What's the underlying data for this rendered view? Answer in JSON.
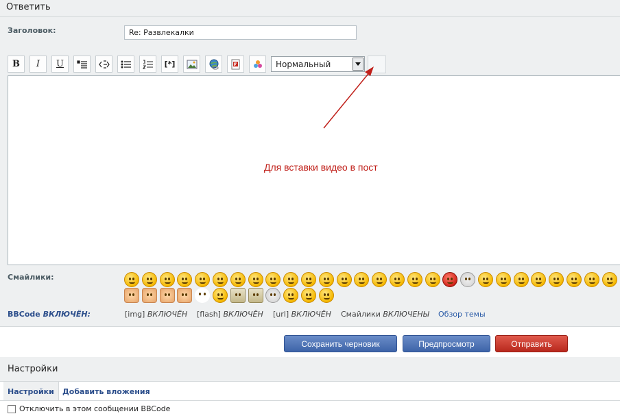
{
  "reply": {
    "title": "Ответить",
    "subject_label": "Заголовок:",
    "subject_value": "Re: Развлекалки"
  },
  "toolbar": {
    "bold": "B",
    "italic": "I",
    "underline": "U",
    "list_item": "[*]",
    "font_size_selected": "Нормальный"
  },
  "annotation": {
    "text": "Для вставки видео в пост",
    "color": "#c0201a"
  },
  "smileys": {
    "label": "Смайлики:",
    "icons": [
      "smile",
      "sad",
      "smile",
      "laugh",
      "cool",
      "confused",
      "neutral",
      "cry",
      "grin",
      "evil-grin",
      "surprised",
      "smile",
      "wink",
      "geek",
      "happy",
      "shocked",
      "sleepy",
      "smile",
      "devil",
      "eye-roll",
      "angry",
      "neutral",
      "neutral",
      "thinking",
      "yell",
      "whistle",
      "sick",
      "dizzy",
      "handshake",
      "fist",
      "thumbs-up",
      "thumbs-down",
      "blank",
      "dollar",
      "mug",
      "beer",
      "hourglass",
      "star",
      "cat",
      "monkey"
    ]
  },
  "bbcode": {
    "label": "BBCode",
    "label_state": "ВКЛЮЧЁН:",
    "img_tag": "[img]",
    "img_state": "ВКЛЮЧЁН",
    "flash_tag": "[flash]",
    "flash_state": "ВКЛЮЧЁН",
    "url_tag": "[url]",
    "url_state": "ВКЛЮЧЁН",
    "smileys_text": "Смайлики",
    "smileys_state": "ВКЛЮЧЕНЫ",
    "topic_review": "Обзор темы"
  },
  "buttons": {
    "save_draft": "Сохранить черновик",
    "preview": "Предпросмотр",
    "submit": "Отправить"
  },
  "settings": {
    "title": "Настройки",
    "tabs": [
      "Настройки",
      "Добавить вложения"
    ],
    "disable_bbcode": "Отключить в этом сообщении BBCode"
  },
  "colors": {
    "panel_bg": "#eef0f1",
    "button_blue": "#3d64a8",
    "button_red": "#b8281d",
    "link": "#2d5da8"
  }
}
